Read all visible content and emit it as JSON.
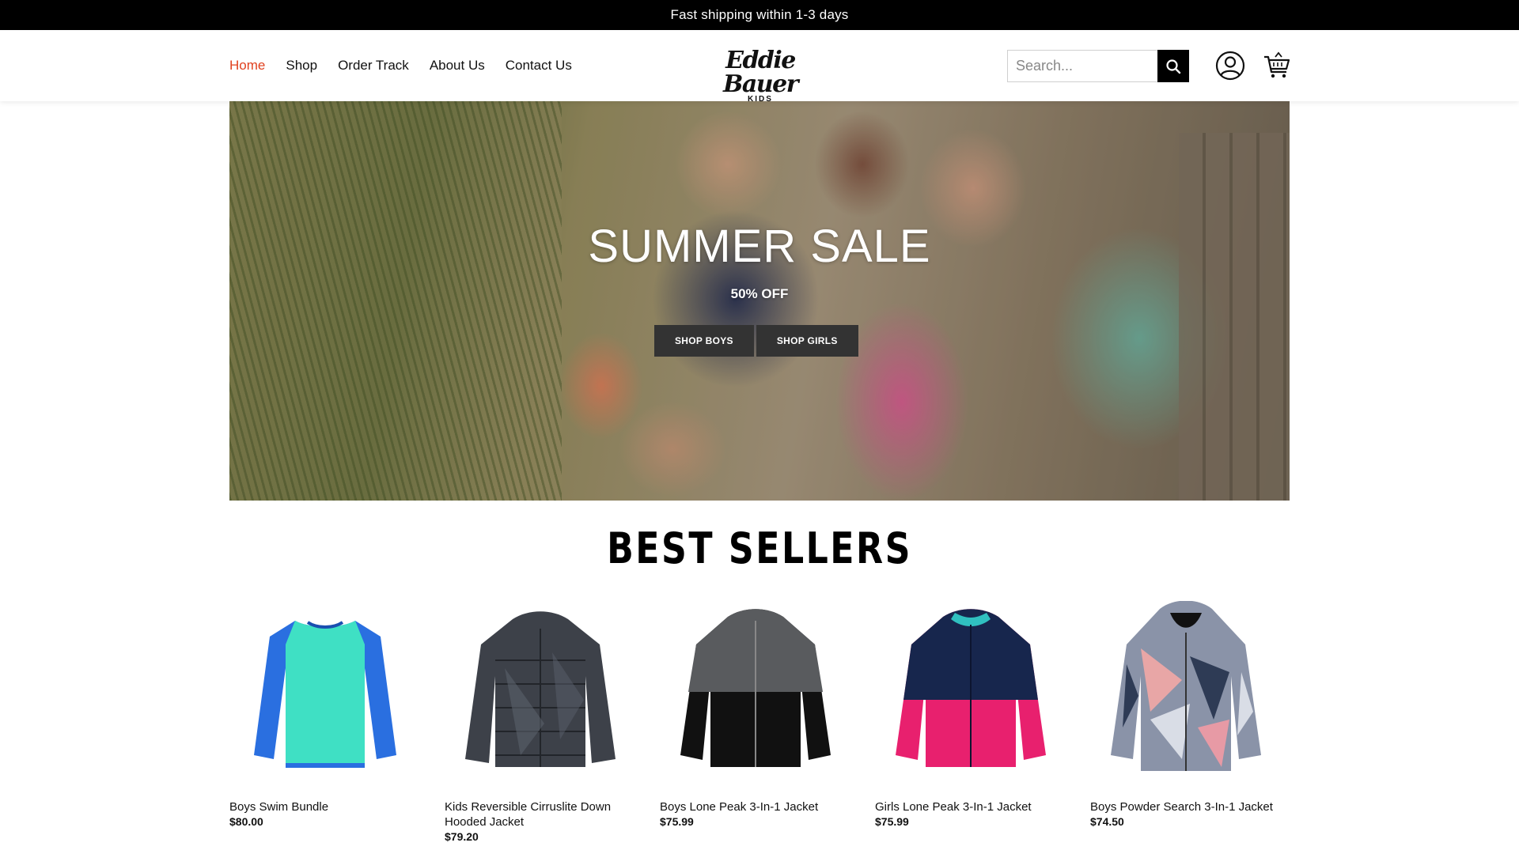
{
  "announcement": {
    "text": "Fast shipping within 1-3 days"
  },
  "nav": {
    "items": [
      {
        "label": "Home",
        "active": true
      },
      {
        "label": "Shop"
      },
      {
        "label": "Order Track"
      },
      {
        "label": "About Us"
      },
      {
        "label": "Contact Us"
      }
    ]
  },
  "logo": {
    "script": "Eddie Bauer",
    "sub": "KIDS"
  },
  "search": {
    "placeholder": "Search..."
  },
  "icons": {
    "search": "search-icon",
    "account": "user-icon",
    "cart": "cart-icon"
  },
  "hero": {
    "title": "SUMMER SALE",
    "subtitle": "50% OFF",
    "buttons": [
      "SHOP BOYS",
      "SHOP GIRLS"
    ]
  },
  "best_sellers": {
    "title": "BEST SELLERS",
    "products": [
      {
        "name": "Boys Swim Bundle",
        "price": "$80.00"
      },
      {
        "name": "Kids Reversible Cirruslite Down Hooded Jacket",
        "price": "$79.20"
      },
      {
        "name": "Boys Lone Peak 3-In-1 Jacket",
        "price": "$75.99"
      },
      {
        "name": "Girls Lone Peak 3-In-1 Jacket",
        "price": "$75.99"
      },
      {
        "name": "Boys Powder Search 3-In-1 Jacket",
        "price": "$74.50"
      }
    ]
  },
  "colors": {
    "accent": "#e0401e",
    "bar": "#000000",
    "button": "#333333"
  }
}
